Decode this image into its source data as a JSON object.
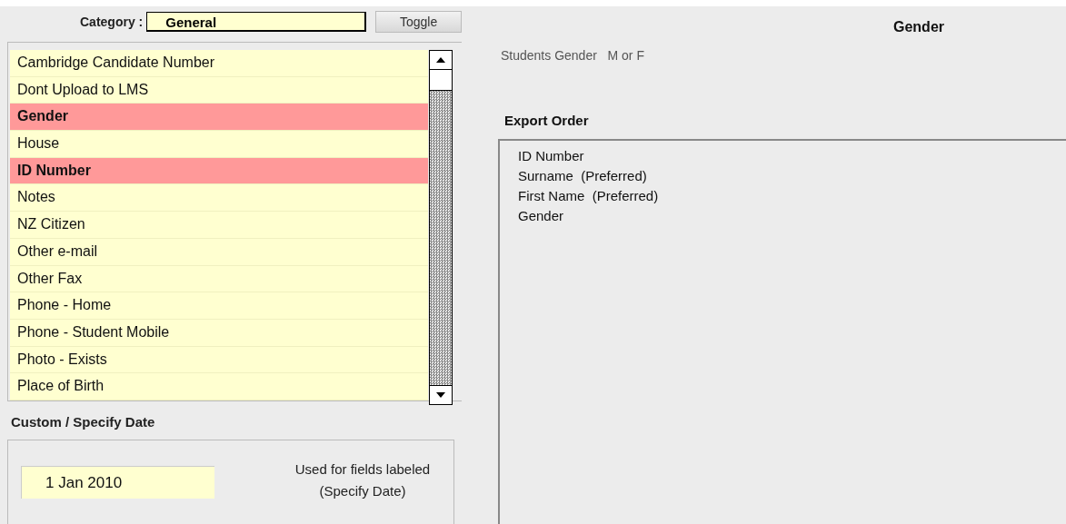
{
  "category": {
    "label": "Category :",
    "value": "General",
    "toggle_button": "Toggle"
  },
  "fields": [
    {
      "label": "Cambridge Candidate Number",
      "selected": false
    },
    {
      "label": "Dont Upload to LMS",
      "selected": false
    },
    {
      "label": "Gender",
      "selected": true
    },
    {
      "label": "House",
      "selected": false
    },
    {
      "label": "ID Number",
      "selected": true
    },
    {
      "label": "Notes",
      "selected": false
    },
    {
      "label": "NZ Citizen",
      "selected": false
    },
    {
      "label": "Other e-mail",
      "selected": false
    },
    {
      "label": "Other Fax",
      "selected": false
    },
    {
      "label": "Phone - Home",
      "selected": false
    },
    {
      "label": "Phone - Student Mobile",
      "selected": false
    },
    {
      "label": "Photo - Exists",
      "selected": false
    },
    {
      "label": "Place of Birth",
      "selected": false
    }
  ],
  "custom_date": {
    "title": "Custom / Specify Date",
    "value": "1 Jan 2010",
    "note": "Used for fields labeled (Specify Date)"
  },
  "detail": {
    "title": "Gender",
    "description": "Students Gender   M or F"
  },
  "export_order": {
    "title": "Export Order",
    "items": [
      "ID Number",
      "Surname  (Preferred)",
      "First Name  (Preferred)",
      "Gender"
    ]
  }
}
